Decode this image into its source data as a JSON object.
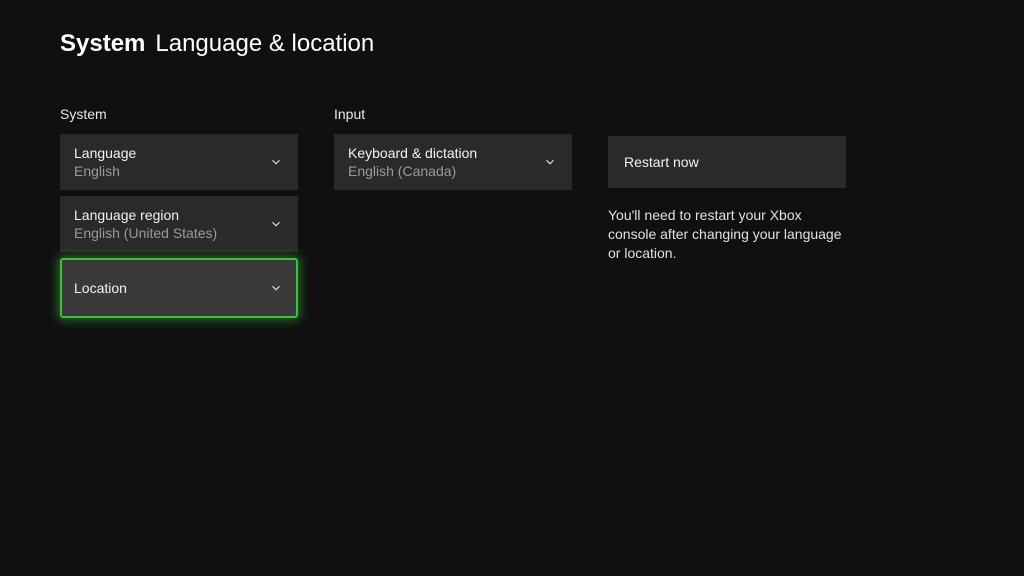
{
  "header": {
    "prefix": "System",
    "title": "Language & location"
  },
  "system": {
    "section_label": "System",
    "language": {
      "label": "Language",
      "value": "English"
    },
    "region": {
      "label": "Language region",
      "value": "English (United States)"
    },
    "location": {
      "label": "Location",
      "value": ""
    }
  },
  "input": {
    "section_label": "Input",
    "keyboard": {
      "label": "Keyboard & dictation",
      "value": "English (Canada)"
    }
  },
  "action": {
    "restart_label": "Restart now",
    "note": "You'll need to restart your Xbox console after changing your language or location."
  }
}
